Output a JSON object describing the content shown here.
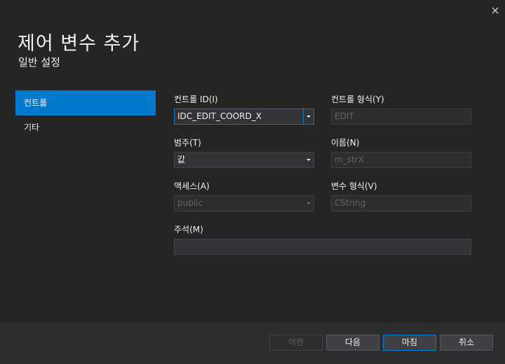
{
  "dialog": {
    "title": "제어 변수 추가",
    "subtitle": "일반 설정"
  },
  "icons": {
    "close": "close-icon",
    "dropdown": "chevron-down-icon"
  },
  "nav": [
    {
      "label": "컨트롤",
      "active": true
    },
    {
      "label": "기타",
      "active": false
    }
  ],
  "form": {
    "control_id": {
      "label": "컨트롤 ID(I)",
      "value": "IDC_EDIT_COORD_X"
    },
    "control_type": {
      "label": "컨트롤 형식(Y)",
      "value": "EDIT"
    },
    "category": {
      "label": "범주(T)",
      "value": "값"
    },
    "name": {
      "label": "이름(N)",
      "value": "m_strX"
    },
    "access": {
      "label": "액세스(A)",
      "value": "public"
    },
    "var_type": {
      "label": "변수 형식(V)",
      "value": "CString"
    },
    "comment": {
      "label": "주석(M)",
      "value": ""
    }
  },
  "buttons": {
    "prev": "이전",
    "next": "다음",
    "finish": "마침",
    "cancel": "취소"
  },
  "colors": {
    "background": "#252526",
    "accent": "#007acc",
    "footer": "#2d2d30"
  }
}
